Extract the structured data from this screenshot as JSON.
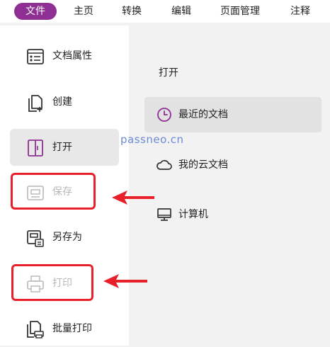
{
  "menubar": {
    "items": [
      {
        "label": "文件",
        "active": true
      },
      {
        "label": "主页",
        "active": false
      },
      {
        "label": "转换",
        "active": false
      },
      {
        "label": "编辑",
        "active": false
      },
      {
        "label": "页面管理",
        "active": false
      },
      {
        "label": "注释",
        "active": false
      }
    ]
  },
  "sidebar": {
    "items": [
      {
        "label": "文档属性",
        "icon": "document-properties-icon"
      },
      {
        "label": "创建",
        "icon": "create-document-icon"
      },
      {
        "label": "打开",
        "icon": "open-book-icon",
        "selected": true
      },
      {
        "label": "保存",
        "icon": "save-icon",
        "disabled": true
      },
      {
        "label": "另存为",
        "icon": "save-as-icon"
      },
      {
        "label": "打印",
        "icon": "printer-icon",
        "disabled": true
      },
      {
        "label": "批量打印",
        "icon": "batch-print-icon"
      }
    ]
  },
  "open_panel": {
    "title": "打开",
    "items": [
      {
        "label": "最近的文档",
        "icon": "clock-icon",
        "selected": true
      },
      {
        "label": "我的云文档",
        "icon": "cloud-icon"
      },
      {
        "label": "计算机",
        "icon": "computer-icon"
      }
    ]
  },
  "watermark": "passneo.cn",
  "colors": {
    "accent": "#8e2f94",
    "highlight": "#e8202a",
    "watermark": "#6b8bd6"
  }
}
